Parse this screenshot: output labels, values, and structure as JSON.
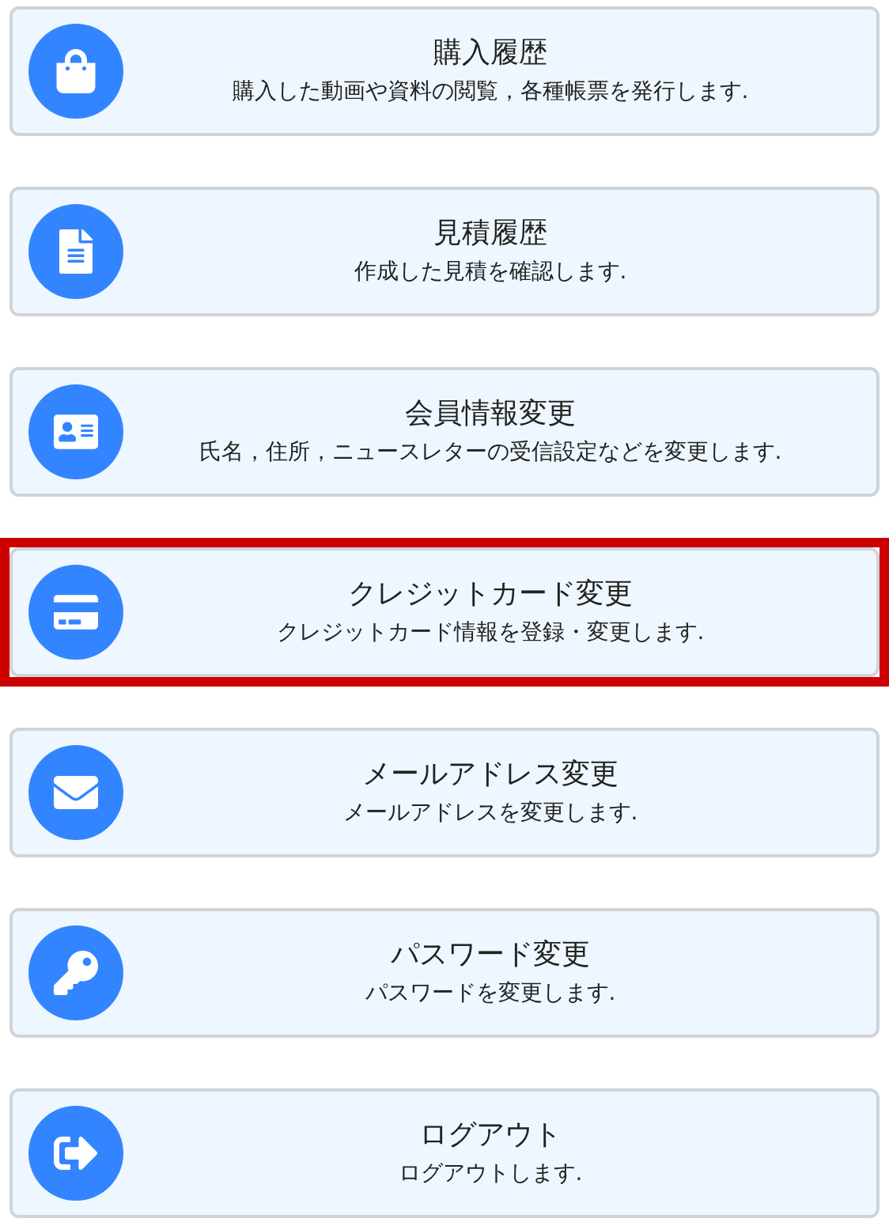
{
  "menu_items": [
    {
      "title": "購入履歴",
      "description": "購入した動画や資料の閲覧，各種帳票を発行します.",
      "highlighted": false
    },
    {
      "title": "見積履歴",
      "description": "作成した見積を確認します.",
      "highlighted": false
    },
    {
      "title": "会員情報変更",
      "description": "氏名，住所，ニュースレターの受信設定などを変更します.",
      "highlighted": false
    },
    {
      "title": "クレジットカード変更",
      "description": "クレジットカード情報を登録・変更します.",
      "highlighted": true
    },
    {
      "title": "メールアドレス変更",
      "description": "メールアドレスを変更します.",
      "highlighted": false
    },
    {
      "title": "パスワード変更",
      "description": "パスワードを変更します.",
      "highlighted": false
    },
    {
      "title": "ログアウト",
      "description": "ログアウトします.",
      "highlighted": false
    }
  ]
}
